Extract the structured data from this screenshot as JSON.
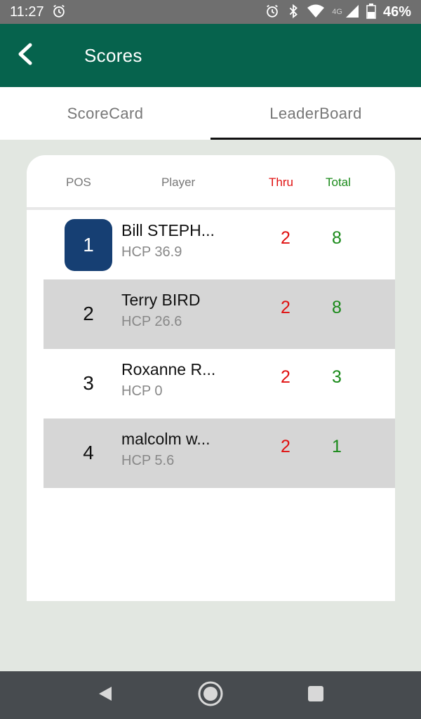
{
  "status_bar": {
    "time": "11:27",
    "network": "4G",
    "battery": "46%"
  },
  "app_bar": {
    "title": "Scores"
  },
  "tabs": [
    {
      "label": "ScoreCard",
      "active": false
    },
    {
      "label": "LeaderBoard",
      "active": true
    }
  ],
  "leaderboard": {
    "headers": {
      "pos": "POS",
      "player": "Player",
      "thru": "Thru",
      "total": "Total"
    },
    "rows": [
      {
        "pos": "1",
        "name": "Bill STEPH...",
        "hcp": "HCP 36.9",
        "thru": "2",
        "total": "8"
      },
      {
        "pos": "2",
        "name": "Terry BIRD",
        "hcp": "HCP 26.6",
        "thru": "2",
        "total": "8"
      },
      {
        "pos": "3",
        "name": "Roxanne R...",
        "hcp": "HCP 0",
        "thru": "2",
        "total": "3"
      },
      {
        "pos": "4",
        "name": "malcolm  w...",
        "hcp": "HCP 5.6",
        "thru": "2",
        "total": "1"
      }
    ]
  },
  "colors": {
    "app_bar": "#06634d",
    "thru": "#e01010",
    "total": "#1a8a1a",
    "leader_badge": "#163f73"
  }
}
